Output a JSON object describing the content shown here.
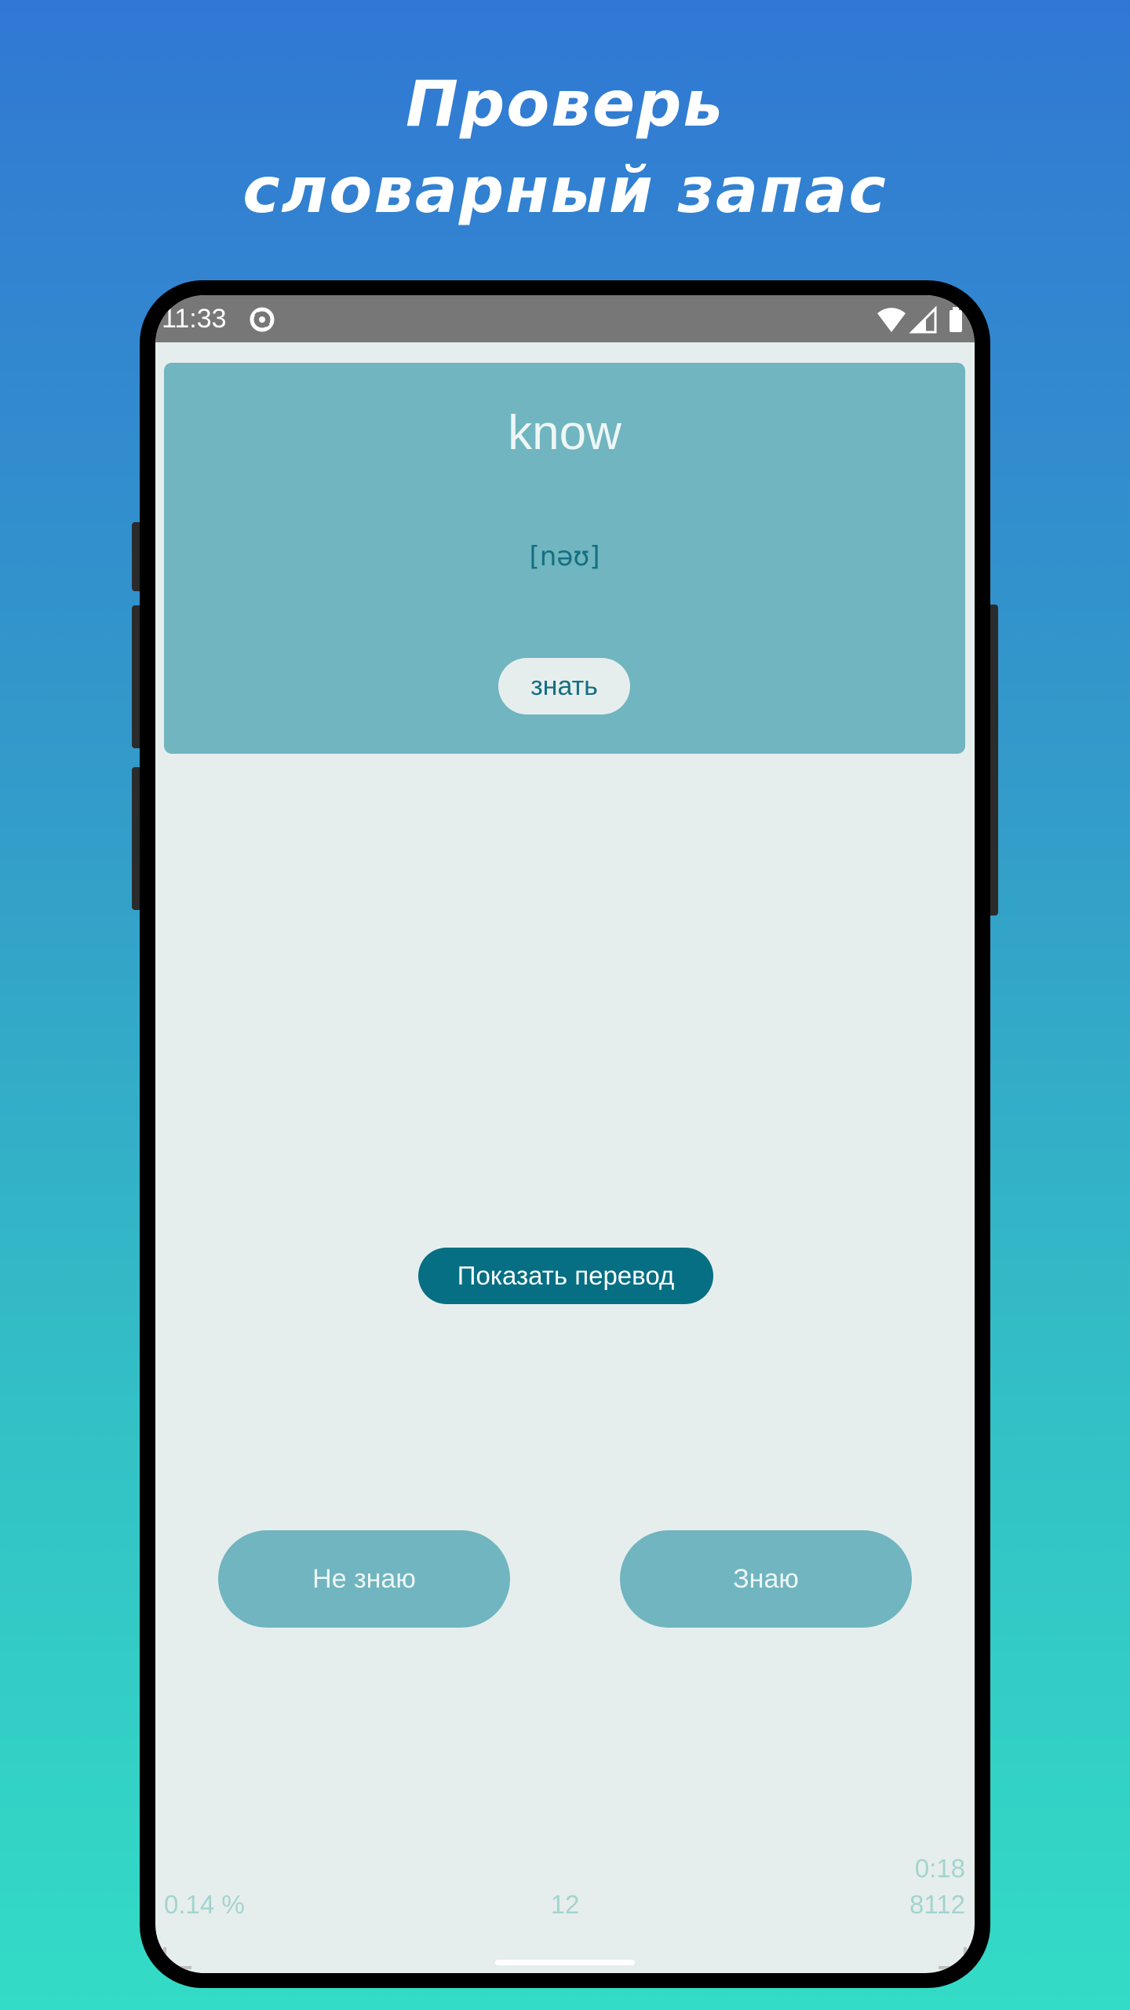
{
  "headline": {
    "line1": "Проверь",
    "line2": "словарный запас"
  },
  "status_bar": {
    "time": "11:33",
    "icons": [
      "sync-icon",
      "wifi-icon",
      "signal-icon",
      "battery-icon"
    ]
  },
  "card": {
    "word": "know",
    "transcription": "[nəʊ]",
    "translation_chip": "знать"
  },
  "show_translation_label": "Показать перевод",
  "answers": {
    "dont_know_label": "Не знаю",
    "know_label": "Знаю"
  },
  "footer": {
    "percent": "0.14 %",
    "count": "12",
    "timer": "0:18",
    "total": "8112"
  },
  "colors": {
    "background_top": "#3178d4",
    "background_bottom": "#33dcc6",
    "card": "#70b5bf",
    "accent": "#066f84",
    "screen_bg": "#e6eeed",
    "footer_text": "#a3d4cf"
  }
}
